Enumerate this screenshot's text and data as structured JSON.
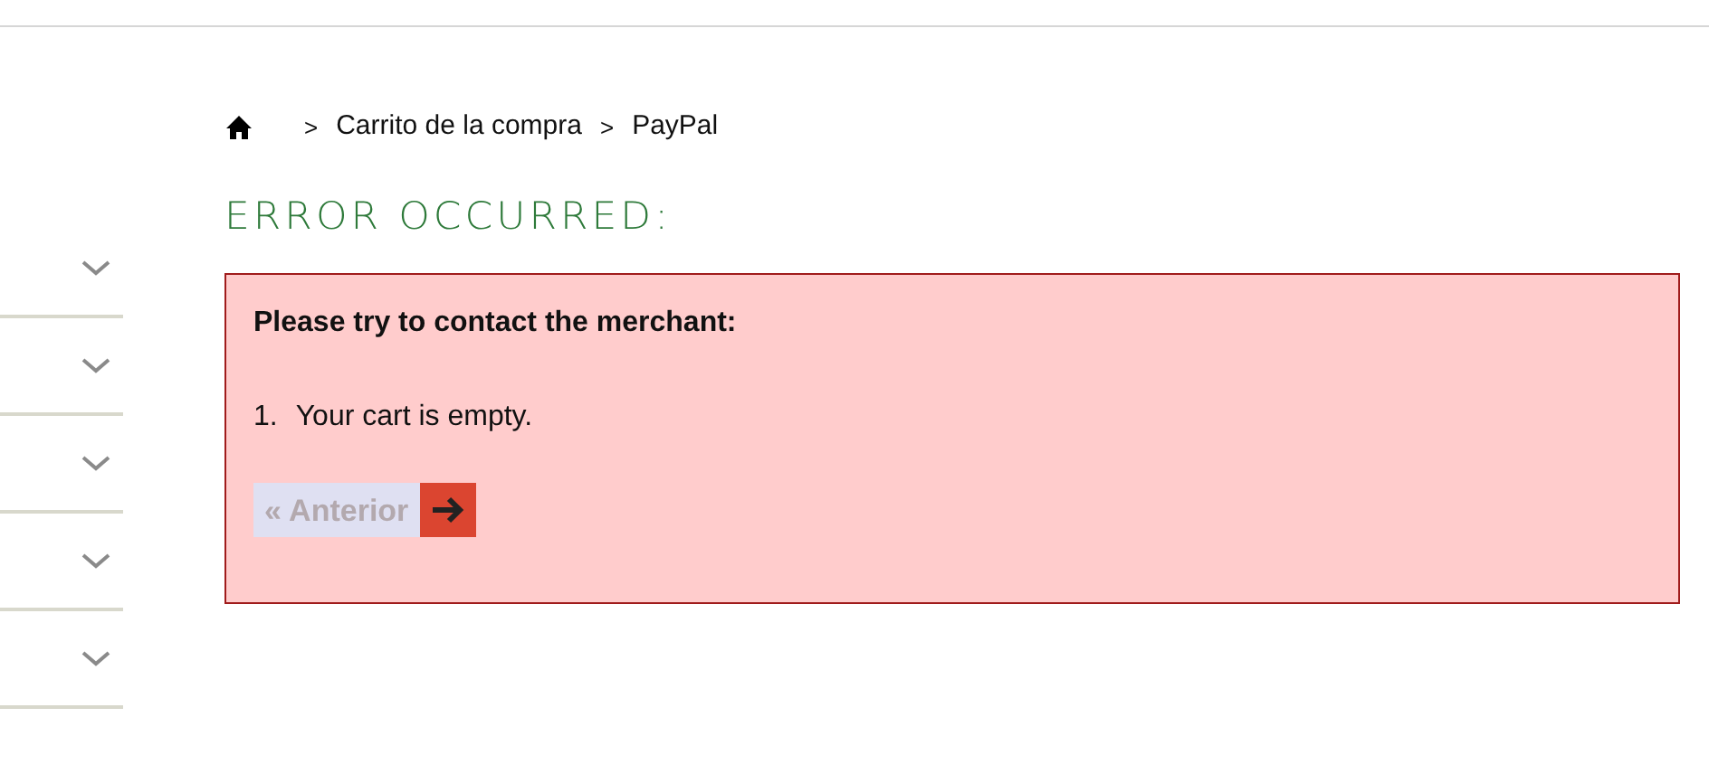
{
  "sidebar": {
    "items": [
      {
        "expanded": false
      },
      {
        "expanded": false
      },
      {
        "expanded": false
      },
      {
        "expanded": false
      },
      {
        "expanded": false
      }
    ]
  },
  "breadcrumb": [
    "Carrito de la compra",
    "PayPal"
  ],
  "breadcrumb_separators": [
    ">",
    ">"
  ],
  "title": "ERROR OCCURRED:",
  "error_box": {
    "heading": "Please try to contact the merchant:",
    "messages": [
      {
        "number": "1.",
        "text": "Your cart is empty."
      }
    ],
    "back_button": {
      "label": "« Anterior",
      "disabled": true
    }
  }
}
